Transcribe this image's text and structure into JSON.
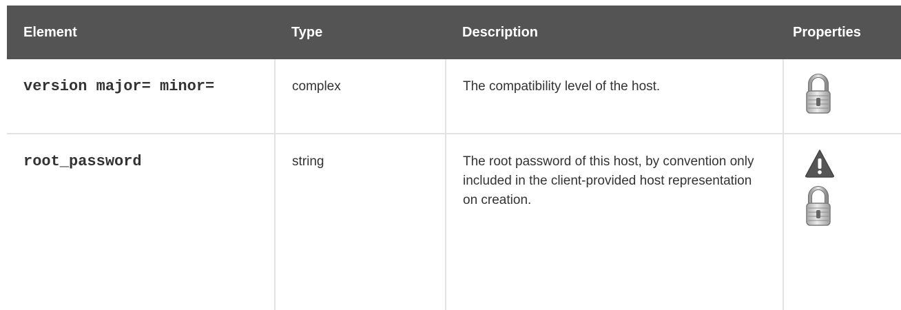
{
  "table": {
    "headers": {
      "element": "Element",
      "type": "Type",
      "description": "Description",
      "properties": "Properties"
    },
    "rows": [
      {
        "element": "version major= minor=",
        "type": "complex",
        "description": "The compatibility level of the host.",
        "properties": [
          "lock-icon"
        ]
      },
      {
        "element": "root_password",
        "type": "string",
        "description": "The root password of this host, by convention only included in the client-provided host representation on creation.",
        "properties": [
          "warning-icon",
          "lock-icon"
        ]
      }
    ]
  },
  "colors": {
    "header_background": "#545454",
    "header_text": "#ffffff",
    "grid_line": "#e3e3e3",
    "body_text": "#333333"
  }
}
